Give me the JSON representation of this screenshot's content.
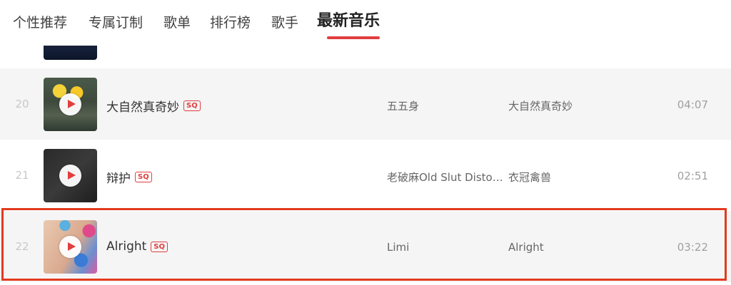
{
  "nav": {
    "tabs": [
      {
        "label": "个性推荐"
      },
      {
        "label": "专属订制"
      },
      {
        "label": "歌单"
      },
      {
        "label": "排行榜"
      },
      {
        "label": "歌手"
      },
      {
        "label": "最新音乐",
        "active": true
      }
    ]
  },
  "songs": [
    {
      "index": "20",
      "title": "大自然真奇妙",
      "quality": "SQ",
      "artist": "五五身",
      "album": "大自然真奇妙",
      "duration": "04:07"
    },
    {
      "index": "21",
      "title": "辩护",
      "quality": "SQ",
      "artist": "老破麻Old Slut Distort...",
      "album": "衣冠禽兽",
      "duration": "02:51"
    },
    {
      "index": "22",
      "title": "Alright",
      "quality": "SQ",
      "artist": "Limi",
      "album": "Alright",
      "duration": "03:22"
    }
  ],
  "colors": {
    "accent": "#e13e3e",
    "highlight_border": "#e33a1f",
    "row_alt_background": "#f5f5f5"
  },
  "icons": {
    "play": "play-icon",
    "quality_badge": "sq-badge"
  }
}
